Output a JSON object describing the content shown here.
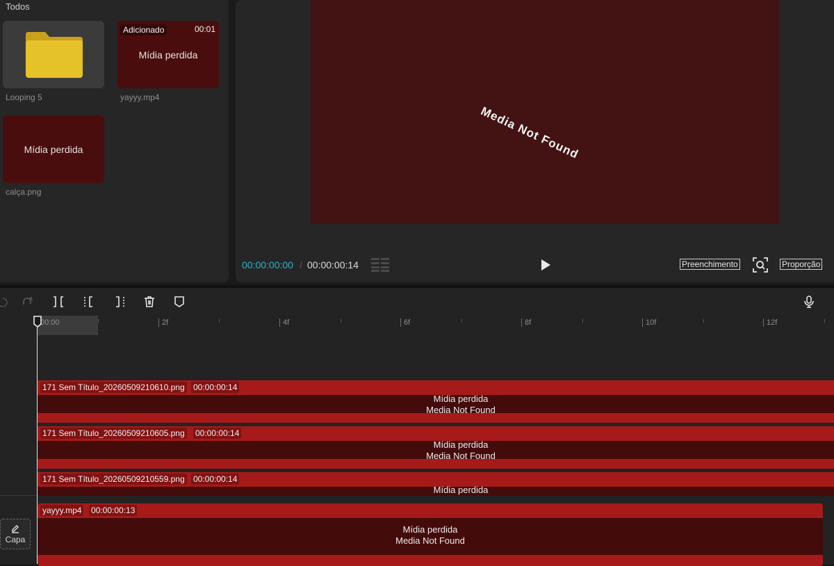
{
  "media": {
    "section_title": "Todos",
    "items": [
      {
        "name": "Looping 5",
        "type": "folder"
      },
      {
        "name": "yayyy.mp4",
        "badge": "Adicionado",
        "duration": "00:01",
        "status": "Mídia perdida"
      },
      {
        "name": "calça.png",
        "status": "Mídia perdida"
      }
    ]
  },
  "player": {
    "preview_text": "Media Not Found",
    "time_current": "00:00:00:00",
    "time_separator": "/",
    "time_total": "00:00:00:14",
    "fill_label": "Preenchimento",
    "ratio_label": "Proporção",
    "colors": {
      "preview_bg": "#431212",
      "timecode": "#2ab3c9"
    }
  },
  "toolbar": {
    "icons": [
      "undo-icon",
      "redo-icon",
      "split-icon",
      "trim-left-icon",
      "trim-right-icon",
      "delete-icon",
      "marker-icon",
      "microphone-icon"
    ]
  },
  "timeline": {
    "ruler_labels": [
      "00:00",
      "2f",
      "4f",
      "6f",
      "8f",
      "10f",
      "12f"
    ],
    "cover_label": "Capa",
    "clips": [
      {
        "filename": "171 Sem Título_20260509210610.png",
        "duration": "00:00:00:14",
        "line1": "Mídia perdida",
        "line2": "Media Not Found"
      },
      {
        "filename": "171 Sem Título_20260509210605.png",
        "duration": "00:00:00:14",
        "line1": "Mídia perdida",
        "line2": "Media Not Found"
      },
      {
        "filename": "171 Sem Título_20260509210559.png",
        "duration": "00:00:00:14",
        "line1": "Mídia perdida"
      },
      {
        "filename": "yayyy.mp4",
        "duration": "00:00:00:13",
        "line1": "Mídia perdida",
        "line2": "Media Not Found"
      }
    ],
    "colors": {
      "clip_header": "#a61a1a",
      "clip_body": "#440b0b"
    }
  }
}
